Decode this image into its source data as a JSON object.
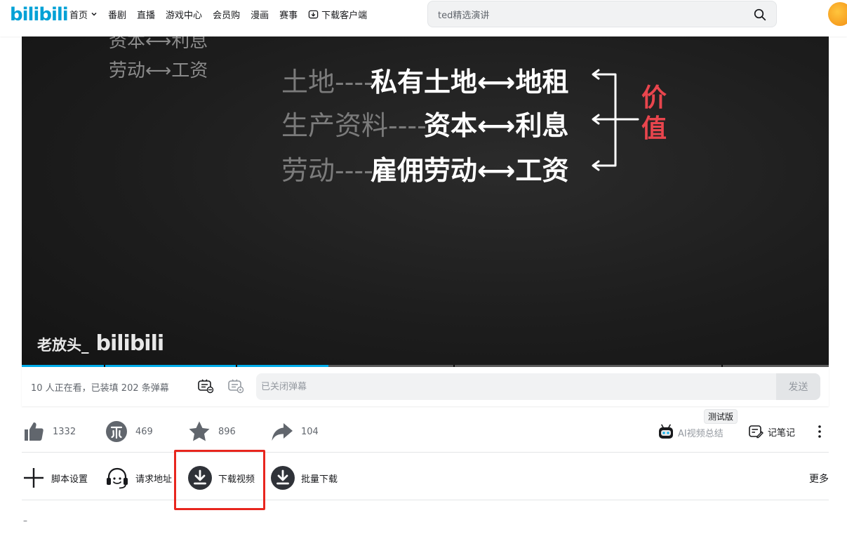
{
  "header": {
    "logo_text": "bilibili",
    "nav": [
      {
        "label": "首页"
      },
      {
        "label": "番剧"
      },
      {
        "label": "直播"
      },
      {
        "label": "游戏中心"
      },
      {
        "label": "会员购"
      },
      {
        "label": "漫画"
      },
      {
        "label": "赛事"
      },
      {
        "label": "下载客户端"
      }
    ],
    "search_placeholder": "ted精选演讲"
  },
  "video": {
    "ghost_rows": [
      "资本⟷利息",
      "劳动⟷工资"
    ],
    "rows": [
      {
        "label": "土地----",
        "main": "私有土地⟷地租"
      },
      {
        "label": "生产资料----",
        "main": "资本⟷利息"
      },
      {
        "label": "劳动----",
        "main": "雇佣劳动⟷工资"
      }
    ],
    "value_word": "价值",
    "watermark_author": "老放头_",
    "watermark_logo": "bilibili",
    "progress_fraction": 0.38
  },
  "danmaku": {
    "info": "10 人正在看，已装填 202 条弹幕",
    "placeholder": "已关闭弹幕",
    "send_label": "发送"
  },
  "toolbar": {
    "like_count": "1332",
    "coin_count": "469",
    "fav_count": "896",
    "share_count": "104",
    "ai_beta": "测试版",
    "ai_summary": "AI视频总结",
    "note": "记笔记"
  },
  "script_bar": {
    "items": [
      {
        "label": "脚本设置"
      },
      {
        "label": "请求地址"
      },
      {
        "label": "下载视频"
      },
      {
        "label": "批量下载"
      }
    ],
    "more": "更多"
  },
  "footer": {
    "dash": "–"
  },
  "colors": {
    "brand": "#00a1d6",
    "highlight": "#e8261e",
    "accent": "#00aeec",
    "value_red": "#e9454d"
  }
}
